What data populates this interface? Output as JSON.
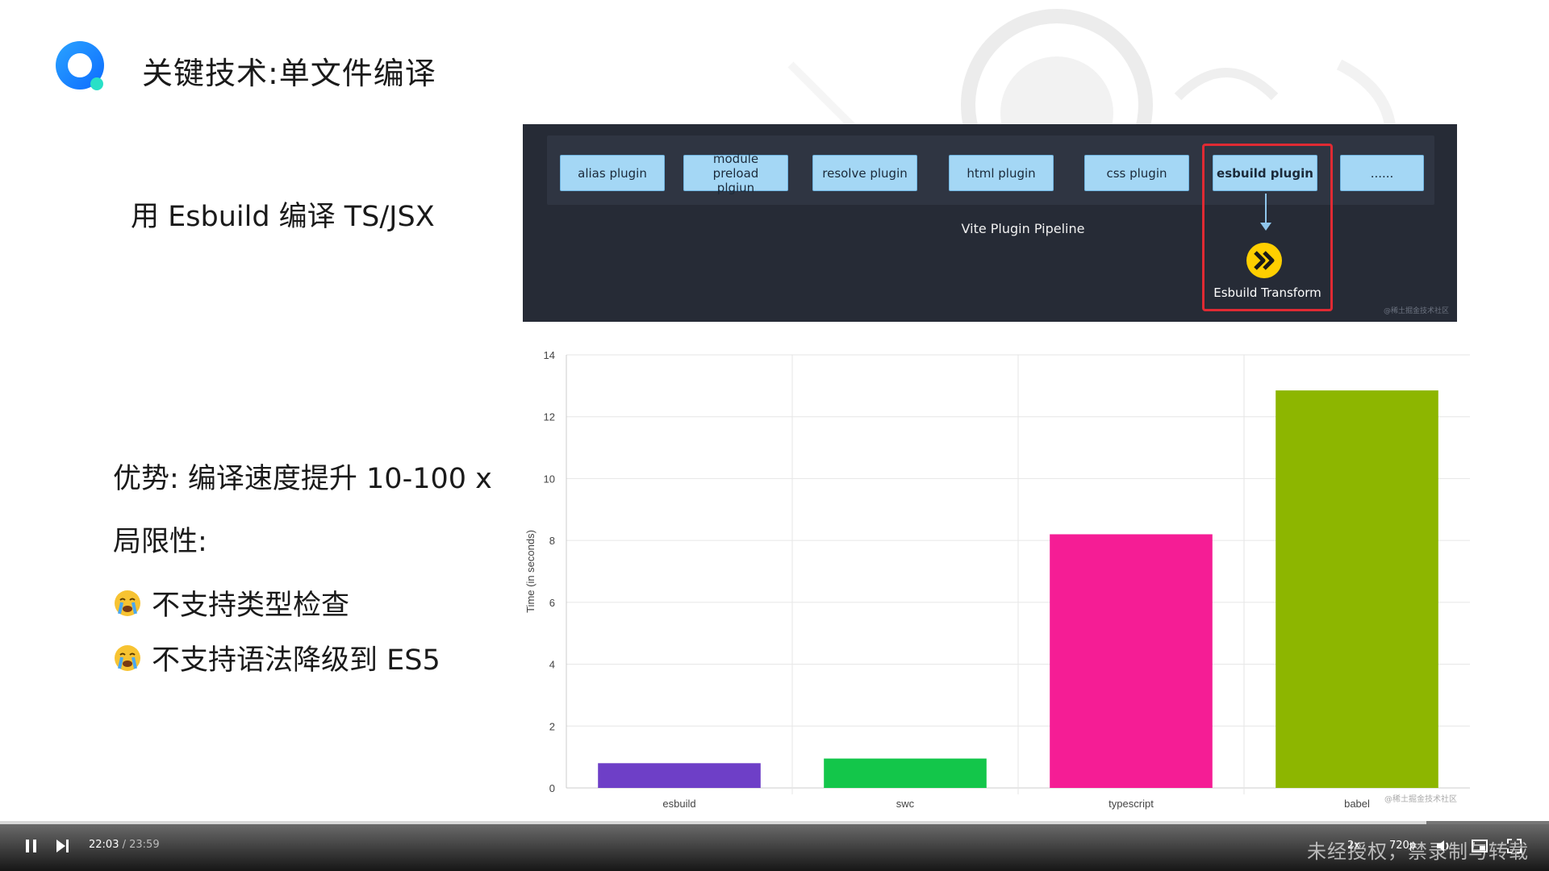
{
  "slide": {
    "title": "关键技术:单文件编译",
    "lead": "用 Esbuild 编译 TS/JSX",
    "advantage": "优势: 编译速度提升 10-100 x",
    "limitation_label": "局限性:",
    "bullets": [
      "不支持类型检查",
      "不支持语法降级到 ES5"
    ]
  },
  "pipeline": {
    "plugins": [
      "alias plugin",
      "module preload plgiun",
      "resolve plugin",
      "html plugin",
      "css plugin",
      "esbuild plugin",
      "......"
    ],
    "pipeline_label": "Vite Plugin Pipeline",
    "transform_label": "Esbuild Transform",
    "watermark": "@稀土掘金技术社区"
  },
  "chart_data": {
    "type": "bar",
    "categories": [
      "esbuild",
      "swc",
      "typescript",
      "babel"
    ],
    "values": [
      0.8,
      0.95,
      8.2,
      12.85
    ],
    "colors": [
      "#6e3fc7",
      "#13c64a",
      "#f51d95",
      "#8db600"
    ],
    "ylabel": "Time (in seconds)",
    "ylim": [
      0,
      14
    ],
    "yticks": [
      0,
      2,
      4,
      6,
      8,
      10,
      12,
      14
    ],
    "grid": true,
    "watermark": "@稀土掘金技术社区"
  },
  "player": {
    "current_time": "22:03",
    "total_time": "/ 23:59",
    "progress": 0.921,
    "speed": "2x",
    "quality": "720p",
    "watermark": "未经授权，禁录制与转载"
  },
  "colors": {
    "pipeline_bg": "#262b36",
    "plugin_bg": "#a4d7f5",
    "highlight": "#e02a33"
  }
}
